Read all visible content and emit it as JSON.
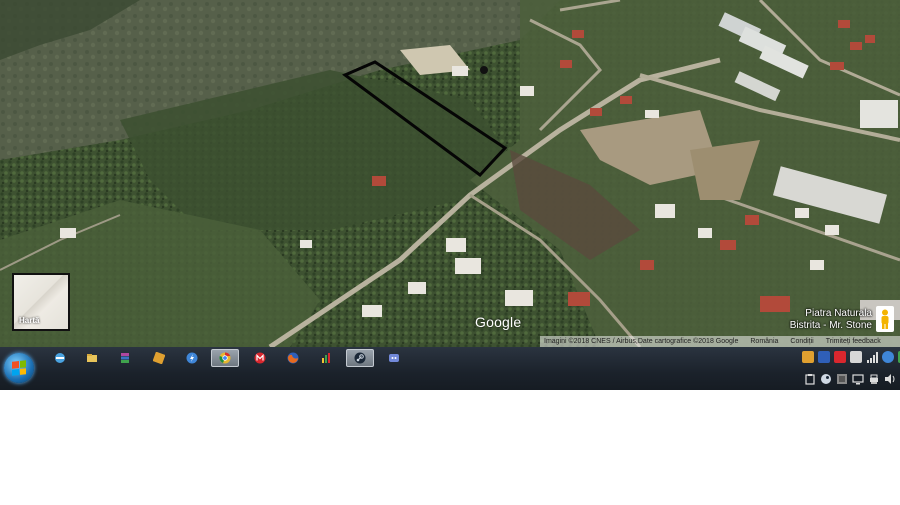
{
  "map": {
    "type_control_label": "Hartă",
    "google_logo": "Google",
    "place_label_line1": "Piatra Naturala",
    "place_label_line2": "Bistrita - Mr. Stone",
    "attribution": {
      "imagery": "Imagini ©2018 CNES / Airbus,Date cartografice ©2018 Google",
      "country": "România",
      "terms": "Condiții",
      "feedback": "Trimiteți feedback"
    }
  },
  "taskbar": {
    "pinned": [
      {
        "name": "ie-icon",
        "color": "#4aa3e0"
      },
      {
        "name": "file-explorer-icon",
        "color": "#e8c45a"
      },
      {
        "name": "winrar-icon",
        "color": "#b0479f"
      },
      {
        "name": "notes-app-icon",
        "color": "#e0a030"
      },
      {
        "name": "lightning-app-icon",
        "color": "#3f86d8"
      },
      {
        "name": "chrome-icon",
        "color": "#e6b630"
      },
      {
        "name": "mega-icon",
        "color": "#d9272e"
      },
      {
        "name": "firefox-icon",
        "color": "#e66a1f"
      },
      {
        "name": "chart-app-icon",
        "color": "#f2c233"
      },
      {
        "name": "steam-icon",
        "color": "#cfd8e3"
      },
      {
        "name": "discord-icon",
        "color": "#7289da"
      }
    ]
  }
}
